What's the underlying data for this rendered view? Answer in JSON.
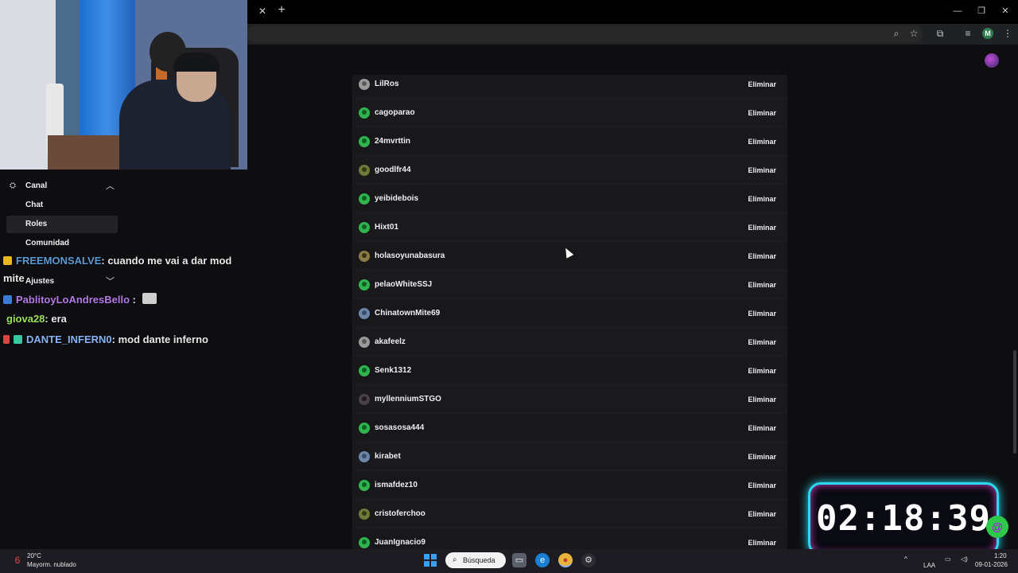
{
  "browser": {
    "close_tab_glyph": "✕",
    "new_tab_glyph": "+",
    "profile_initial": "M"
  },
  "nav": {
    "section_label": "Canal",
    "items": [
      {
        "label": "Chat",
        "active": false
      },
      {
        "label": "Roles",
        "active": true
      },
      {
        "label": "Comunidad",
        "active": false
      }
    ],
    "settings_label": "Ajustes"
  },
  "chat": {
    "messages": [
      {
        "user": "FREEMONSALVE",
        "text": ": cuando me vai a dar mod",
        "user_color": "#5b9bd5"
      },
      {
        "user": "",
        "text": "mite",
        "user_color": "#ffffff"
      },
      {
        "user": "PablitoyLoAndresBello",
        "text": " :",
        "user_color": "#b57ae8"
      },
      {
        "user": "giova28",
        "text": ": era",
        "user_color": "#9be35a"
      },
      {
        "user": "DANTE_INFERN0",
        "text": ": mod dante inferno",
        "user_color": "#8ab4f8"
      }
    ]
  },
  "members": {
    "remove_label": "Eliminar",
    "rows": [
      {
        "name": "LilRos",
        "avatar": "gray"
      },
      {
        "name": "cagoparao",
        "avatar": "green"
      },
      {
        "name": "24mvrttin",
        "avatar": "green"
      },
      {
        "name": "goodlfr44",
        "avatar": "olive"
      },
      {
        "name": "yeibidebois",
        "avatar": "green"
      },
      {
        "name": "Hixt01",
        "avatar": "green"
      },
      {
        "name": "holasoyunabasura",
        "avatar": "gold"
      },
      {
        "name": "pelaoWhiteSSJ",
        "avatar": "green"
      },
      {
        "name": "ChinatownMite69",
        "avatar": "blue"
      },
      {
        "name": "akafeelz",
        "avatar": "gray"
      },
      {
        "name": "Senk1312",
        "avatar": "green"
      },
      {
        "name": "myllenniumSTGO",
        "avatar": "dark"
      },
      {
        "name": "sosasosa444",
        "avatar": "green"
      },
      {
        "name": "kirabet",
        "avatar": "blue"
      },
      {
        "name": "ismafdez10",
        "avatar": "green"
      },
      {
        "name": "cristoferchoo",
        "avatar": "olive"
      },
      {
        "name": "JuanIgnacio9",
        "avatar": "green"
      }
    ]
  },
  "timer": {
    "value": "02:18:39",
    "frame_color": "#2ad8f0",
    "glow_color": "#d43ac2"
  },
  "taskbar": {
    "weather_badge": "6",
    "temperature": "20°C",
    "weather": "Mayorm. nublado",
    "search_label": "Búsqueda",
    "input_lang": "LAA",
    "time": "1:20",
    "date": "09-01-2026"
  }
}
